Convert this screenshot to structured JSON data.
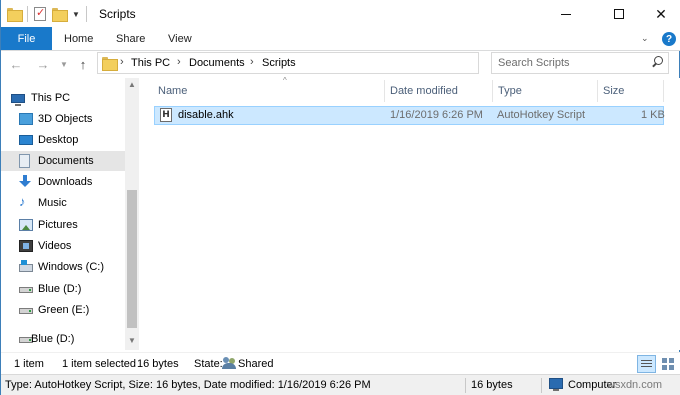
{
  "window": {
    "title": "Scripts",
    "close_glyph": "✕"
  },
  "ribbon": {
    "file": "File",
    "tabs": [
      "Home",
      "Share",
      "View"
    ],
    "help": "?"
  },
  "address": {
    "crumbs": [
      "This PC",
      "Documents",
      "Scripts"
    ],
    "search_placeholder": "Search Scripts"
  },
  "navpane": {
    "items": [
      {
        "label": "This PC",
        "icon": "computer-icon"
      },
      {
        "label": "3D Objects",
        "icon": "3d-objects-icon"
      },
      {
        "label": "Desktop",
        "icon": "desktop-icon"
      },
      {
        "label": "Documents",
        "icon": "documents-icon",
        "selected": true
      },
      {
        "label": "Downloads",
        "icon": "downloads-icon"
      },
      {
        "label": "Music",
        "icon": "music-icon"
      },
      {
        "label": "Pictures",
        "icon": "pictures-icon"
      },
      {
        "label": "Videos",
        "icon": "videos-icon"
      },
      {
        "label": "Windows (C:)",
        "icon": "windows-drive-icon"
      },
      {
        "label": "Blue (D:)",
        "icon": "drive-icon"
      },
      {
        "label": "Green (E:)",
        "icon": "drive-icon"
      },
      {
        "label": "Blue (D:)",
        "icon": "drive-icon"
      }
    ]
  },
  "filelist": {
    "columns": [
      "Name",
      "Date modified",
      "Type",
      "Size"
    ],
    "rows": [
      {
        "name": "disable.ahk",
        "date": "1/16/2019 6:26 PM",
        "type": "AutoHotkey Script",
        "size": "1 KB",
        "icon_letter": "H"
      }
    ]
  },
  "status": {
    "count": "1 item",
    "selected": "1 item selected",
    "bytes": "16 bytes",
    "state_label": "State:",
    "state_value": "Shared"
  },
  "details": {
    "summary": "Type: AutoHotkey Script, Size: 16 bytes, Date modified: 1/16/2019 6:26 PM",
    "size": "16 bytes",
    "location": "Computer",
    "watermark": "wsxdn.com"
  },
  "colors": {
    "accent": "#1979ca",
    "selection": "#cce8ff",
    "selection_border": "#99d1ff"
  }
}
